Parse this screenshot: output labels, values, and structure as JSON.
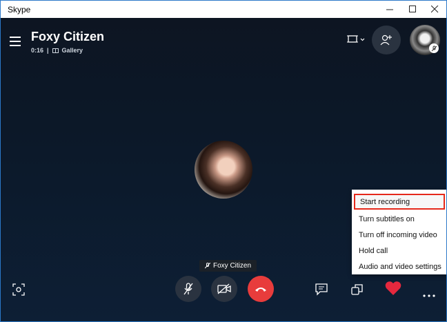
{
  "window": {
    "title": "Skype"
  },
  "call": {
    "contact_name": "Foxy Citizen",
    "duration": "0:16",
    "separator": "|",
    "view_mode": "Gallery",
    "participant_label": "Foxy Citizen"
  },
  "more_menu": {
    "items": [
      "Start recording",
      "Turn subtitles on",
      "Turn off incoming video",
      "Hold call",
      "Audio and video settings"
    ],
    "highlighted_index": 0
  },
  "colors": {
    "end_call": "#e83c3c",
    "heart": "#e5283e",
    "highlight_border": "#e5281b"
  },
  "icons": [
    "menu-icon",
    "screen-layout-icon",
    "chevron-down-icon",
    "add-person-icon",
    "microphone-muted-icon",
    "video-off-icon",
    "hang-up-icon",
    "chat-icon",
    "switch-view-icon",
    "heart-icon",
    "more-icon",
    "snapshot-icon"
  ]
}
